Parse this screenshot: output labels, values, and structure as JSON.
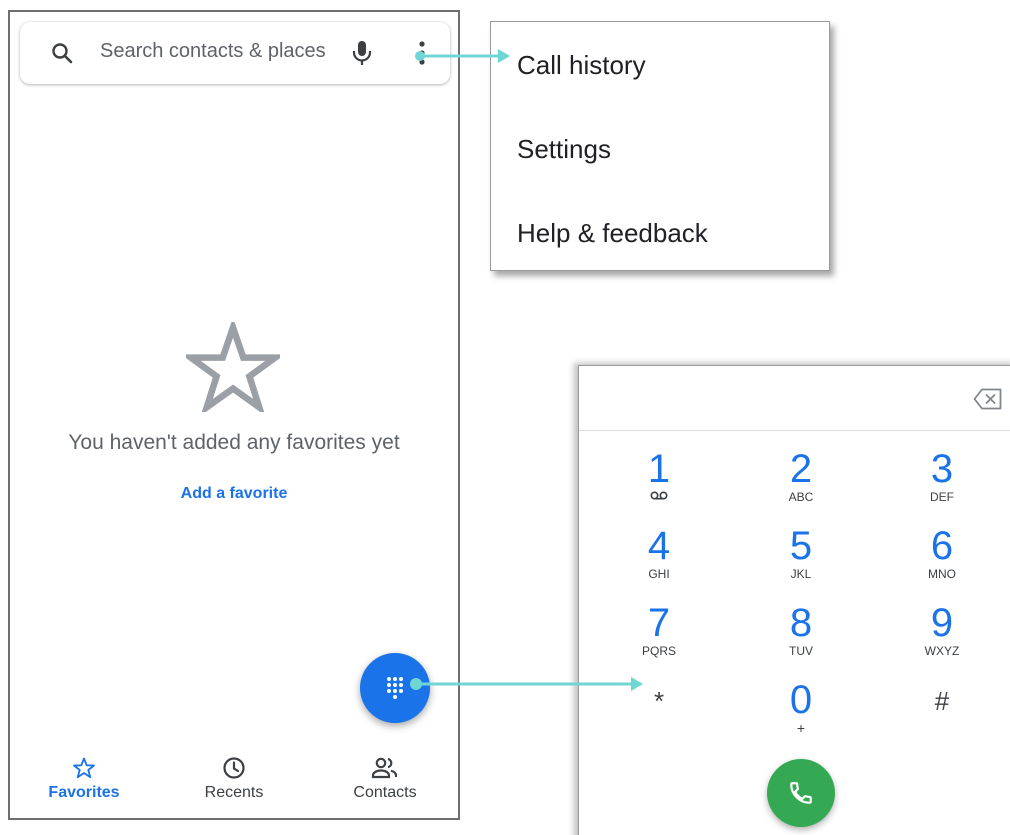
{
  "search": {
    "placeholder": "Search contacts & places"
  },
  "favorites": {
    "empty_message": "You haven't added any favorites yet",
    "add_link": "Add a favorite"
  },
  "bottom_nav": {
    "items": [
      {
        "label": "Favorites",
        "icon": "star-outline-icon",
        "selected": true
      },
      {
        "label": "Recents",
        "icon": "clock-icon",
        "selected": false
      },
      {
        "label": "Contacts",
        "icon": "people-icon",
        "selected": false
      }
    ]
  },
  "menu": {
    "items": [
      {
        "label": "Call history"
      },
      {
        "label": "Settings"
      },
      {
        "label": "Help & feedback"
      }
    ]
  },
  "dialpad": {
    "keys": [
      {
        "digit": "1",
        "letters": ""
      },
      {
        "digit": "2",
        "letters": "ABC"
      },
      {
        "digit": "3",
        "letters": "DEF"
      },
      {
        "digit": "4",
        "letters": "GHI"
      },
      {
        "digit": "5",
        "letters": "JKL"
      },
      {
        "digit": "6",
        "letters": "MNO"
      },
      {
        "digit": "7",
        "letters": "PQRS"
      },
      {
        "digit": "8",
        "letters": "TUV"
      },
      {
        "digit": "9",
        "letters": "WXYZ"
      },
      {
        "digit": "*",
        "letters": ""
      },
      {
        "digit": "0",
        "letters": "+"
      },
      {
        "digit": "#",
        "letters": ""
      }
    ]
  },
  "colors": {
    "accent_blue": "#1a73e8",
    "call_green": "#34a853",
    "callout_cyan": "#6fd6d6",
    "text_gray": "#5f6368"
  }
}
